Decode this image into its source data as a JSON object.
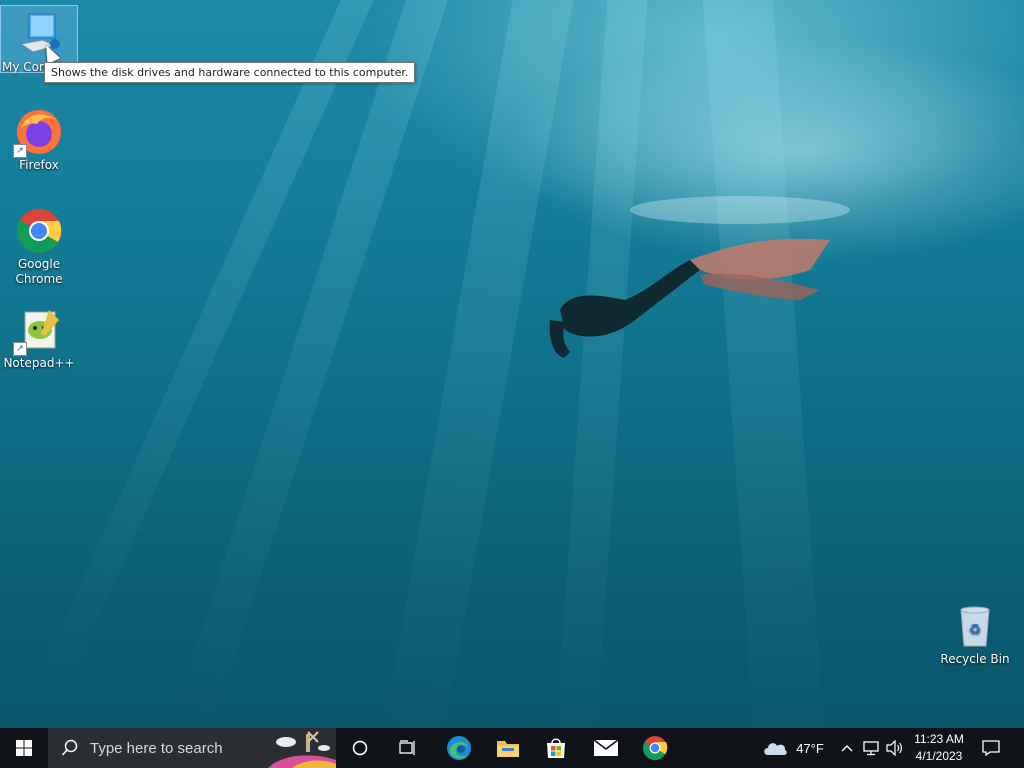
{
  "desktop": {
    "icons": [
      {
        "label": "My Computer",
        "visible_label": "My Con"
      },
      {
        "label": "Firefox"
      },
      {
        "label": "Google Chrome"
      },
      {
        "label": "Notepad++"
      },
      {
        "label": "Recycle Bin"
      }
    ],
    "tooltip": "Shows the disk drives and hardware connected to this computer."
  },
  "taskbar": {
    "search_placeholder": "Type here to search",
    "pinned": [
      "cortana-icon",
      "task-view-icon",
      "edge-icon",
      "file-explorer-icon",
      "store-icon",
      "mail-icon",
      "chrome-icon"
    ],
    "weather": {
      "temp": "47°F",
      "icon": "cloud-icon"
    },
    "clock": {
      "time": "11:23 AM",
      "date": "4/1/2023"
    }
  },
  "colors": {
    "taskbar": "#101418",
    "search": "#2b2e33",
    "selection": "#78bef0"
  }
}
